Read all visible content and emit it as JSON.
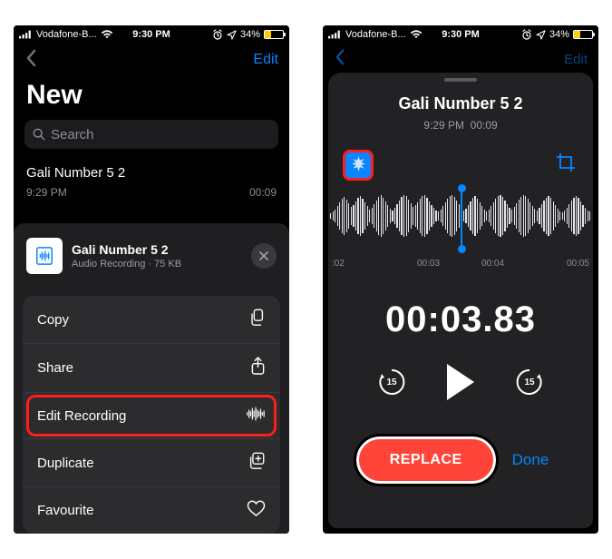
{
  "status": {
    "carrier": "Vodafone-B...",
    "time": "9:30 PM",
    "battery_pct": "34%",
    "battery_fill_pct": 34
  },
  "left": {
    "edit_label": "Edit",
    "title": "New",
    "search_placeholder": "Search",
    "recording": {
      "title": "Gali Number 5 2",
      "time": "9:29 PM",
      "duration": "00:09"
    },
    "sheet": {
      "title": "Gali Number 5 2",
      "subtitle": "Audio Recording · 75 KB",
      "actions": {
        "copy": "Copy",
        "share": "Share",
        "edit_recording": "Edit Recording",
        "duplicate": "Duplicate",
        "favourite": "Favourite"
      }
    }
  },
  "right": {
    "edit_label": "Edit",
    "title": "Gali Number 5 2",
    "sub_time": "9:29 PM",
    "sub_dur": "00:09",
    "ticks": {
      "t1": ":02",
      "t2": "00:03",
      "t3": "00:04",
      "t4": "00:05"
    },
    "current_time": "00:03.83",
    "skip_seconds": "15",
    "replace_label": "REPLACE",
    "done_label": "Done"
  }
}
